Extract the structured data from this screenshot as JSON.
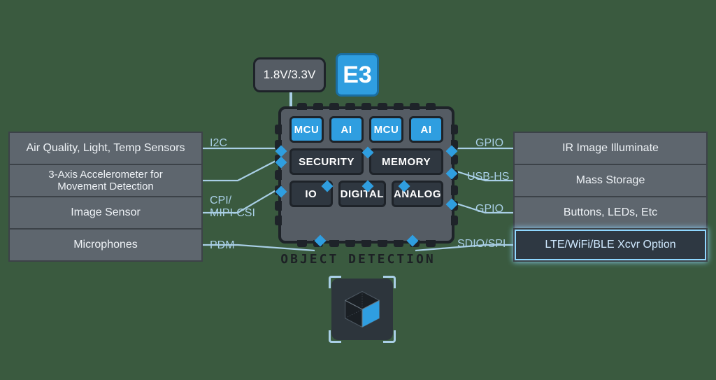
{
  "badge": "E3",
  "voltage": "1.8V/3.3V",
  "caption": "OBJECT DETECTION",
  "left_panels": [
    {
      "label": "Air Quality, Light, Temp Sensors",
      "highlight": false
    },
    {
      "label": "3-Axis Accelerometer for\nMovement Detection",
      "highlight": false
    },
    {
      "label": "Image Sensor",
      "highlight": false
    },
    {
      "label": "Microphones",
      "highlight": false
    }
  ],
  "right_panels": [
    {
      "label": "IR Image Illuminate",
      "highlight": false
    },
    {
      "label": "Mass Storage",
      "highlight": false
    },
    {
      "label": "Buttons, LEDs, Etc",
      "highlight": false
    },
    {
      "label": "LTE/WiFi/BLE Xcvr Option",
      "highlight": true
    }
  ],
  "left_bus": [
    "I2C",
    "",
    "CPI/\nMIPI-CSI",
    "PDM"
  ],
  "right_bus": [
    "GPIO",
    "USB-HS",
    "GPIO",
    "SDIO/SPI"
  ],
  "chip_cells": [
    [
      {
        "t": "MCU",
        "c": "blue"
      },
      {
        "t": "AI",
        "c": "blue"
      },
      {
        "t": "MCU",
        "c": "blue"
      },
      {
        "t": "AI",
        "c": "blue"
      }
    ],
    [
      {
        "t": "SECURITY",
        "c": "dark"
      },
      {
        "t": "MEMORY",
        "c": "dark"
      }
    ],
    [
      {
        "t": "IO",
        "c": "dark"
      },
      {
        "t": "DIGITAL",
        "c": "dark"
      },
      {
        "t": "ANALOG",
        "c": "dark"
      }
    ]
  ],
  "colors": {
    "accent": "#2f9ee0",
    "wire": "#a9cfe6"
  }
}
